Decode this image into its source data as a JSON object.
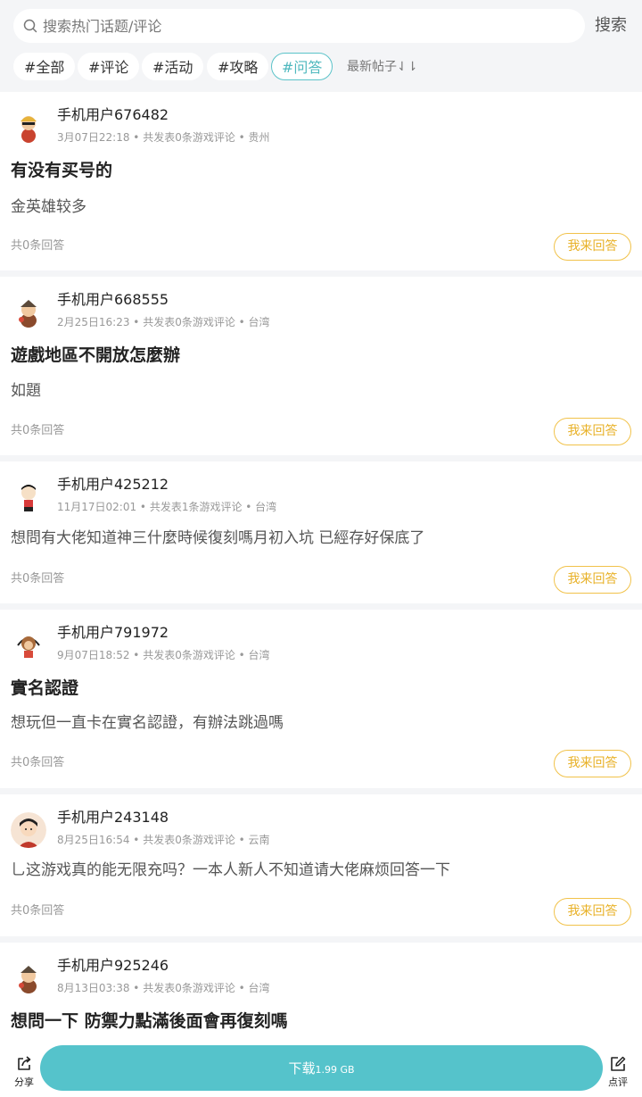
{
  "search": {
    "placeholder": "搜索热门话题/评论",
    "button_label": "搜索"
  },
  "tags": [
    {
      "label": "#全部",
      "active": false
    },
    {
      "label": "#评论",
      "active": false
    },
    {
      "label": "#活动",
      "active": false
    },
    {
      "label": "#攻略",
      "active": false
    },
    {
      "label": "#问答",
      "active": true
    }
  ],
  "sort_label": "最新帖子⇃⇂",
  "posts": [
    {
      "username": "手机用户676482",
      "meta": "3月07日22:18 • 共发表0条游戏评论 • 贵州",
      "title": "有没有买号的",
      "body": "金英雄较多",
      "count": "共0条回答",
      "answer_label": "我来回答"
    },
    {
      "username": "手机用户668555",
      "meta": "2月25日16:23 • 共发表0条游戏评论 • 台湾",
      "title": "遊戲地區不開放怎麼辦",
      "body": "如題",
      "count": "共0条回答",
      "answer_label": "我来回答"
    },
    {
      "username": "手机用户425212",
      "meta": "11月17日02:01 • 共发表1条游戏评论 • 台湾",
      "title": "",
      "body": "想問有大佬知道神三什麼時候復刻嗎月初入坑 已經存好保底了",
      "count": "共0条回答",
      "answer_label": "我来回答"
    },
    {
      "username": "手机用户791972",
      "meta": "9月07日18:52 • 共发表0条游戏评论 • 台湾",
      "title": "實名認證",
      "body": "想玩但一直卡在實名認證，有辦法跳過嗎",
      "count": "共0条回答",
      "answer_label": "我来回答"
    },
    {
      "username": "手机用户243148",
      "meta": "8月25日16:54 • 共发表0条游戏评论 • 云南",
      "title": "",
      "body": "乚这游戏真的能无限充吗？一本人新人不知道请大佬麻烦回答一下",
      "count": "共0条回答",
      "answer_label": "我来回答"
    },
    {
      "username": "手机用户925246",
      "meta": "8月13日03:38 • 共发表0条游戏评论 • 台湾",
      "title": "想問一下 防禦力點滿後面會再復刻嗎",
      "body": "",
      "count": "",
      "answer_label": ""
    }
  ],
  "bottom": {
    "share_label": "分享",
    "download_label": "下载",
    "download_size": "1.99 GB",
    "rate_label": "点评"
  },
  "colors": {
    "accent": "#55c3cb",
    "answer_border": "#f1c24a",
    "tag_active": "#5bc3c9"
  }
}
